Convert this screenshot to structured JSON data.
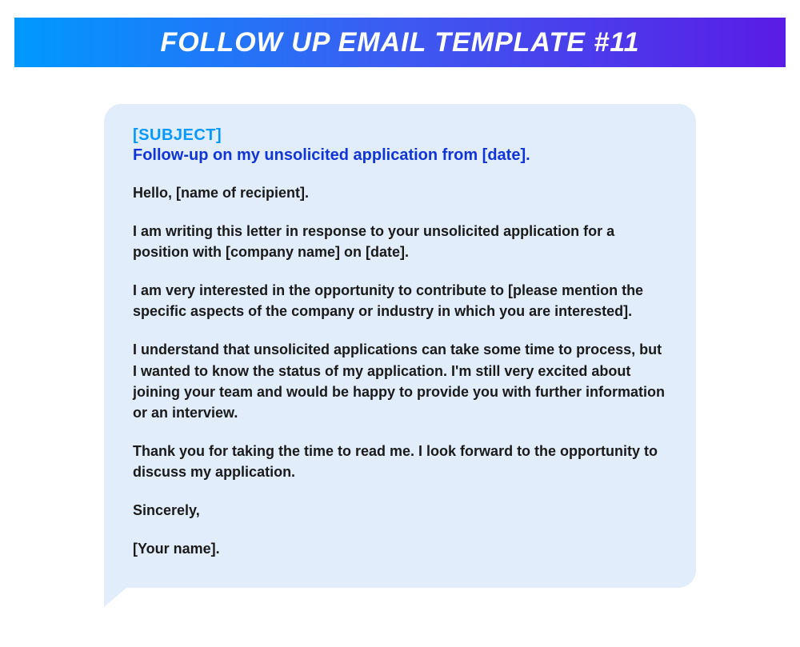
{
  "header": {
    "title": "FOLLOW UP EMAIL TEMPLATE #11"
  },
  "email": {
    "subject_label": "[SUBJECT]",
    "subject_line": "Follow-up on my unsolicited application from [date].",
    "greeting": "Hello, [name of recipient].",
    "para1": "I am writing this letter in response to your unsolicited application for a position with [company name] on [date].",
    "para2": "I am very interested in the opportunity to contribute to [please mention the specific aspects of the company or industry in which you are interested].",
    "para3": "I understand that unsolicited applications can take some time to process, but I wanted to know the status of my application. I'm still very excited about joining your team and would be happy to provide you with further information or an interview.",
    "para4": "Thank you for taking the time to read me. I look forward to the opportunity to discuss my application.",
    "closing": "Sincerely,",
    "signature": "[Your name]."
  }
}
